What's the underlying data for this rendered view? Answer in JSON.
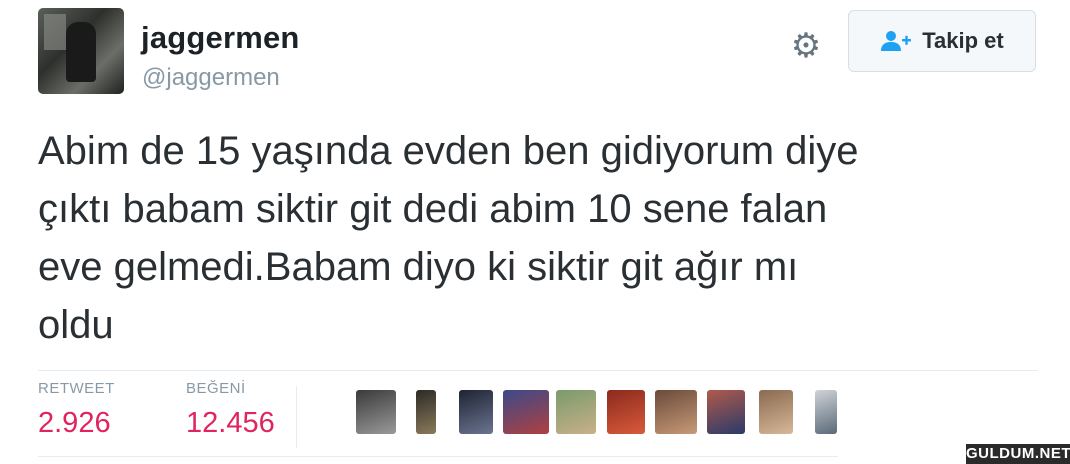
{
  "user": {
    "display_name": "jaggermen",
    "handle": "@jaggermen"
  },
  "follow_button": {
    "label": "Takip et",
    "icon": "add-user-icon"
  },
  "settings_icon": "gear-icon",
  "tweet": {
    "lines": [
      "Abim de 15 yaşında evden ben gidiyorum diye",
      "çıktı babam siktir git dedi abim 10 sene falan",
      "eve gelmedi.Babam diyo ki siktir git ağır mı",
      "oldu"
    ]
  },
  "stats": {
    "retweet_label": "RETWEET",
    "retweet_count": "2.926",
    "like_label": "BEĞENİ",
    "like_count": "12.456"
  },
  "likers": [
    {
      "name": "liker-avatar-1",
      "colors": [
        "#3a3a3a",
        "#9a9a9a"
      ]
    },
    {
      "name": "liker-avatar-2",
      "colors": [
        "#2d2a26",
        "#8a7a5a"
      ]
    },
    {
      "name": "liker-avatar-3",
      "colors": [
        "#1f2433",
        "#6a7590"
      ]
    },
    {
      "name": "liker-avatar-4",
      "colors": [
        "#3b4a8a",
        "#b04040"
      ]
    },
    {
      "name": "liker-avatar-5",
      "colors": [
        "#7a9b6a",
        "#c9b08a"
      ]
    },
    {
      "name": "liker-avatar-6",
      "colors": [
        "#8a2a1e",
        "#d95a3a"
      ]
    },
    {
      "name": "liker-avatar-7",
      "colors": [
        "#6a4a3a",
        "#c89a78"
      ]
    },
    {
      "name": "liker-avatar-8",
      "colors": [
        "#b05a4a",
        "#2a3a6a"
      ]
    },
    {
      "name": "liker-avatar-9",
      "colors": [
        "#8a6a50",
        "#d8b898"
      ]
    },
    {
      "name": "liker-avatar-10",
      "colors": [
        "#cfd3d6",
        "#5a6a7a"
      ]
    }
  ],
  "watermark": "GULDUM.NET"
}
